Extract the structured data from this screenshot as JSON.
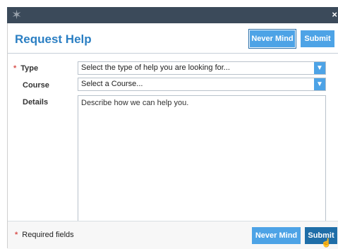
{
  "window": {
    "logo_icon": "star-logo-icon",
    "close_glyph": "×"
  },
  "dialog": {
    "title": "Request Help",
    "buttons": {
      "never_mind": "Never Mind",
      "submit": "Submit"
    }
  },
  "form": {
    "type": {
      "label": "Type",
      "required_mark": "*",
      "selected": "Select the type of help you are looking for..."
    },
    "course": {
      "label": "Course",
      "selected": "Select a Course..."
    },
    "details": {
      "label": "Details",
      "placeholder": "Describe how we can help you."
    }
  },
  "footer": {
    "required_mark": "*",
    "required_note": "Required fields",
    "never_mind": "Never Mind",
    "submit": "Submit"
  },
  "colors": {
    "accent": "#4da3e6",
    "title": "#2b7fc3",
    "titlebar": "#3b4a5a",
    "required": "#d9534f"
  }
}
